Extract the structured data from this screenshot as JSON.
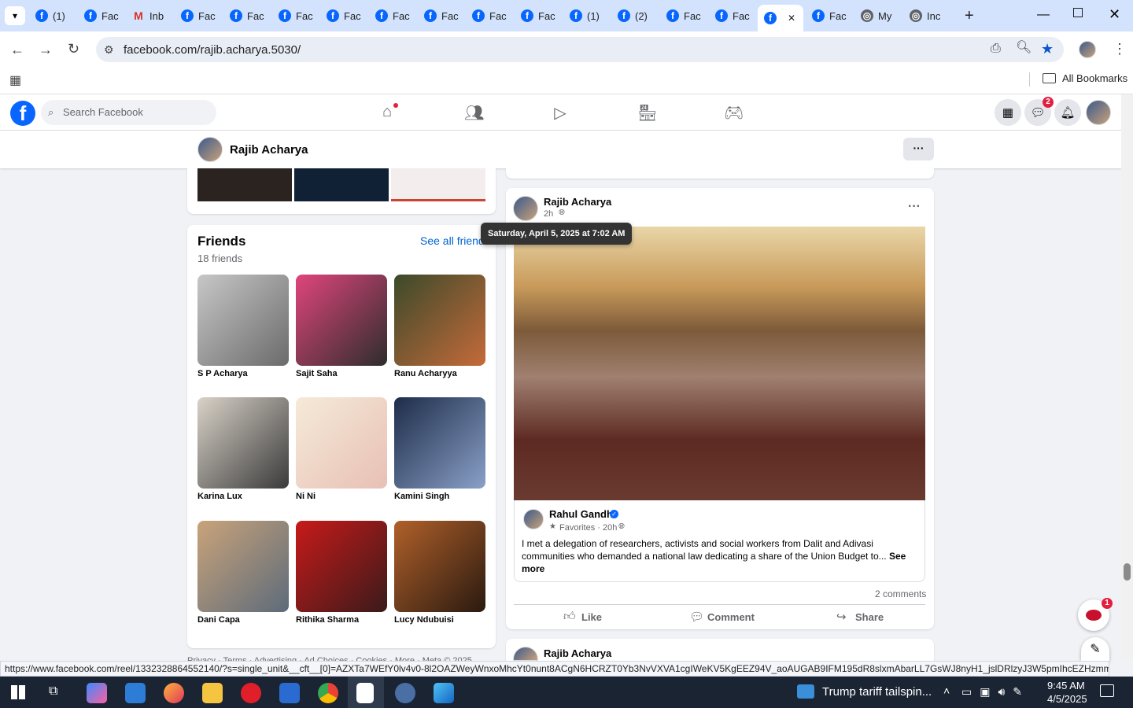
{
  "browser": {
    "tabs": [
      {
        "label": "(1)",
        "icon": "facebook-icon"
      },
      {
        "label": "Fac",
        "icon": "facebook-icon"
      },
      {
        "label": "Inb",
        "icon": "gmail-icon"
      },
      {
        "label": "Fac",
        "icon": "facebook-icon"
      },
      {
        "label": "Fac",
        "icon": "facebook-icon"
      },
      {
        "label": "Fac",
        "icon": "facebook-icon"
      },
      {
        "label": "Fac",
        "icon": "facebook-icon"
      },
      {
        "label": "Fac",
        "icon": "facebook-icon"
      },
      {
        "label": "Fac",
        "icon": "facebook-icon"
      },
      {
        "label": "Fac",
        "icon": "facebook-icon"
      },
      {
        "label": "Fac",
        "icon": "facebook-icon"
      },
      {
        "label": "(1)",
        "icon": "facebook-icon"
      },
      {
        "label": "(2)",
        "icon": "facebook-icon"
      },
      {
        "label": "Fac",
        "icon": "facebook-icon"
      },
      {
        "label": "Fac",
        "icon": "facebook-icon"
      },
      {
        "label": "",
        "icon": "facebook-icon",
        "active": true
      },
      {
        "label": "Fac",
        "icon": "facebook-icon"
      },
      {
        "label": "My",
        "icon": "globe-icon"
      },
      {
        "label": "Inc",
        "icon": "globe-icon"
      }
    ],
    "url": "facebook.com/rajib.acharya.5030/",
    "bookmarks_label": "All Bookmarks",
    "status_url": "https://www.facebook.com/reel/1332328864552140/?s=single_unit&__cft__[0]=AZXTa7WEfY0lv4v0-8l2OAZWeyWnxoMhcYt0nunt8ACgN6HCRZT0Yb3NvVXVA1cgIWeKV5KgEEZ94V_aoAUGAB9IFM195dR8slxmAbarLL7GsWJ8nyH1_jslDRlzyJ3W5pmIhcEZHzmmJvoR_..."
  },
  "facebook": {
    "search_placeholder": "Search Facebook",
    "messenger_badge": "2",
    "profile_name": "Rajib Acharya"
  },
  "friends": {
    "title": "Friends",
    "count": "18 friends",
    "see_all": "See all friends",
    "items": [
      {
        "name": "S P Acharya"
      },
      {
        "name": "Sajit Saha"
      },
      {
        "name": "Ranu Acharyya"
      },
      {
        "name": "Karina Lux"
      },
      {
        "name": "Ni Ni"
      },
      {
        "name": "Kamini Singh"
      },
      {
        "name": "Dani Capa"
      },
      {
        "name": "Rithika Sharma"
      },
      {
        "name": "Lucy Ndubuisi"
      }
    ]
  },
  "prev_actions": {
    "like": "Like",
    "comment": "Comment",
    "share": "Share"
  },
  "post": {
    "author": "Rajib Acharya",
    "time": "2h",
    "tooltip": "Saturday, April 5, 2025 at 7:02 AM",
    "shared": {
      "author": "Rahul Gandhi",
      "meta": "Favorites · 20h ·",
      "text": "I met a delegation of researchers, activists and social workers from Dalit and Adivasi communities who demanded a national law dedicating a share of the Union Budget to...",
      "see_more": "See more"
    },
    "comments": "2 comments",
    "like": "Like",
    "comment": "Comment",
    "share": "Share"
  },
  "next_post": {
    "author": "Rajib Acharya"
  },
  "footer_partial": "Privacy · Terms · Advertising · Ad Choices · Cookies · More · Meta © 2025",
  "chat_badge": "1",
  "taskbar": {
    "news": "Trump tariff tailspin...",
    "time": "9:45 AM",
    "date": "4/5/2025"
  }
}
